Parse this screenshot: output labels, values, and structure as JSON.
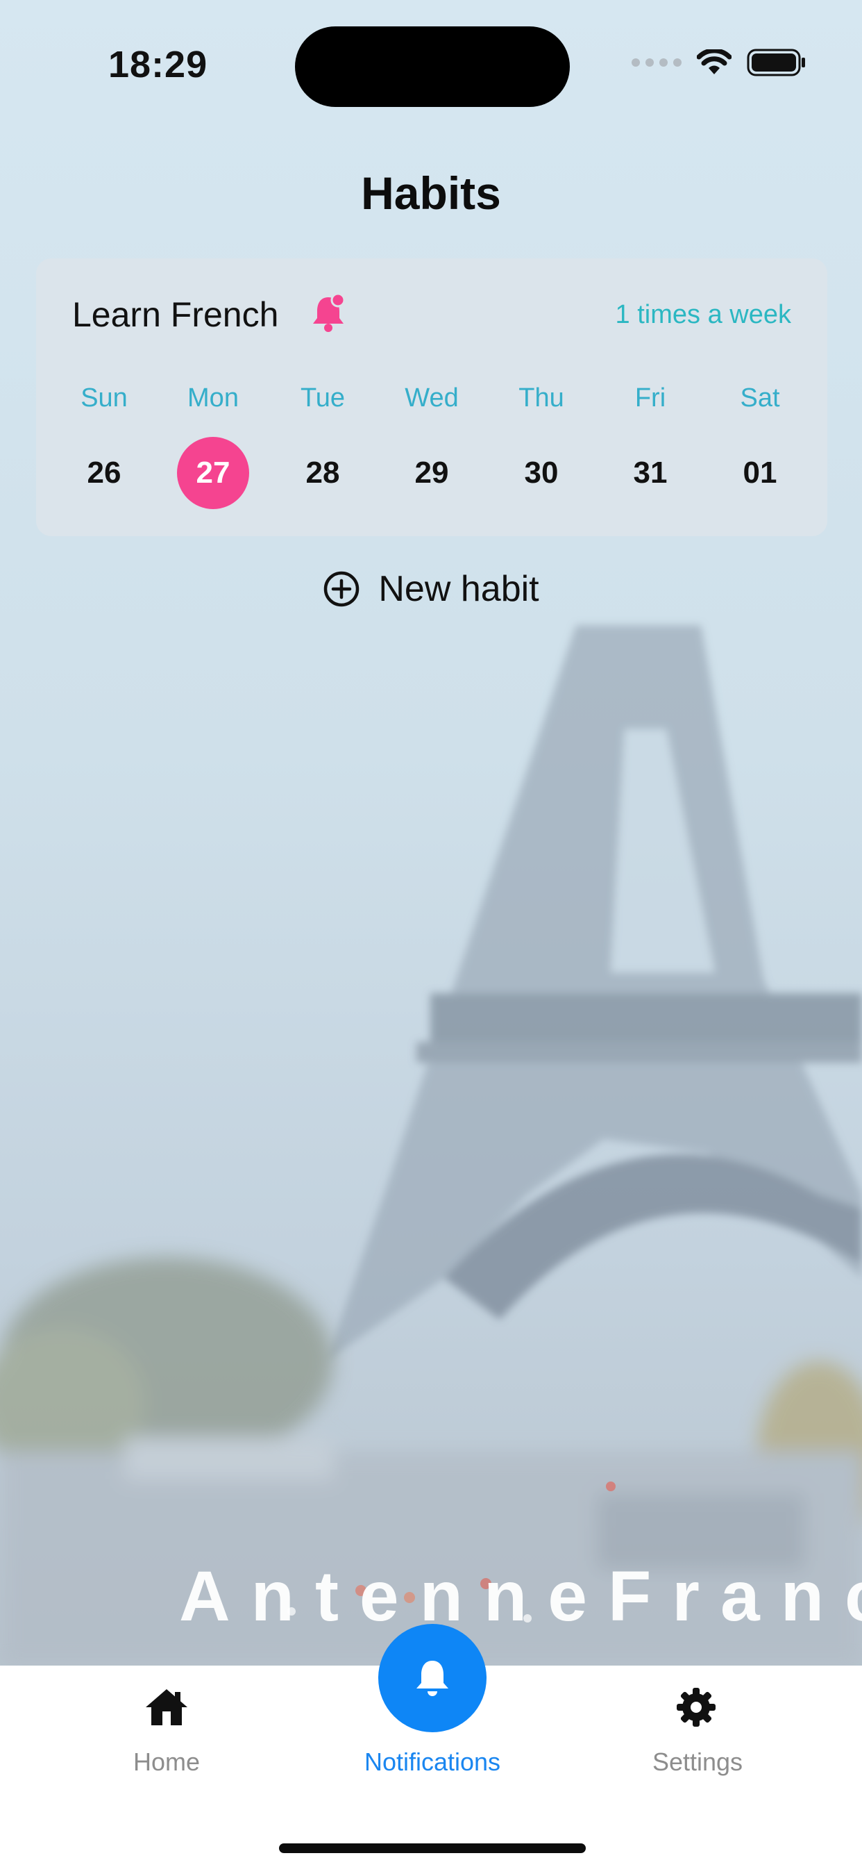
{
  "status_bar": {
    "time": "18:29"
  },
  "header": {
    "title": "Habits"
  },
  "habit": {
    "name": "Learn French",
    "frequency": "1 times a week",
    "days": [
      {
        "name": "Sun",
        "date": "26"
      },
      {
        "name": "Mon",
        "date": "27",
        "selected": true
      },
      {
        "name": "Tue",
        "date": "28"
      },
      {
        "name": "Wed",
        "date": "29"
      },
      {
        "name": "Thu",
        "date": "30"
      },
      {
        "name": "Fri",
        "date": "31"
      },
      {
        "name": "Sat",
        "date": "01"
      }
    ]
  },
  "new_habit": {
    "label": "New habit"
  },
  "watermark": "AntenneFrance",
  "tabs": [
    {
      "label": "Home",
      "icon": "house-icon"
    },
    {
      "label": "Notifications",
      "icon": "bell-icon"
    },
    {
      "label": "Settings",
      "icon": "gear-icon"
    }
  ],
  "colors": {
    "accent_pink": "#f54490",
    "accent_teal": "#2bb7c2",
    "active_blue": "#0e86f6"
  }
}
